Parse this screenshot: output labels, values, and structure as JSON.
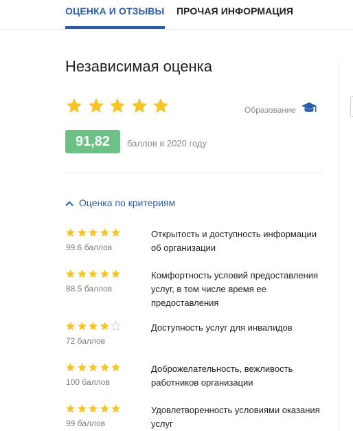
{
  "tabs": [
    {
      "label": "ОЦЕНКА И ОТЗЫВЫ",
      "active": true
    },
    {
      "label": "ПРОЧАЯ ИНФОРМАЦИЯ",
      "active": false
    }
  ],
  "rating": {
    "title": "Независимая оценка",
    "stars": 5,
    "max_stars": 5,
    "category_label": "Образование",
    "category_icon": "graduation-cap-icon",
    "score": "91,82",
    "score_caption": "баллов в 2020 году"
  },
  "criteria": {
    "toggle_label": "Оценка по критериям",
    "toggle_icon": "chevron-up-icon",
    "items": [
      {
        "stars": 5,
        "score": "99.6 баллов",
        "name": "Открытость и доступность информации об организации"
      },
      {
        "stars": 5,
        "score": "88.5 баллов",
        "name": "Комфортность условий предоставления услуг, в том числе время ее предоставления"
      },
      {
        "stars": 4,
        "score": "72 баллов",
        "name": "Доступность услуг для инвалидов"
      },
      {
        "stars": 5,
        "score": "100 баллов",
        "name": "Доброжелательность, вежливость работников организации"
      },
      {
        "stars": 5,
        "score": "99 баллов",
        "name": "Удовлетворенность условиями оказания услуг"
      }
    ]
  },
  "colors": {
    "accent": "#2a5ca8",
    "star": "#f7c325",
    "star_empty": "#c9c9c9",
    "score_badge": "#6dc187",
    "muted_text": "#8a8a8a"
  }
}
